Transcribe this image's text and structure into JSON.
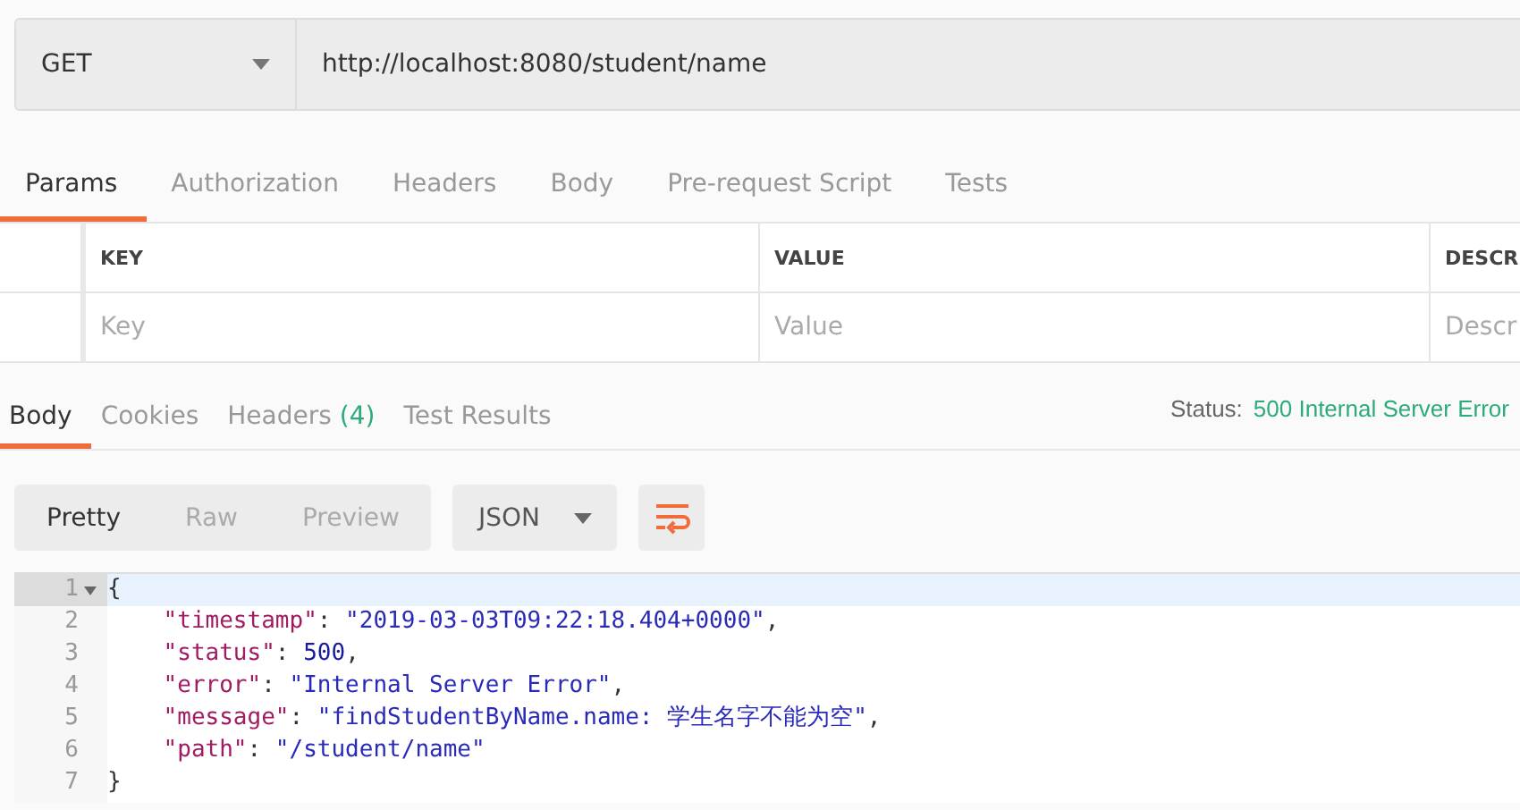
{
  "request": {
    "method": "GET",
    "url": "http://localhost:8080/student/name"
  },
  "request_tabs": [
    {
      "label": "Params",
      "selected": true
    },
    {
      "label": "Authorization",
      "selected": false
    },
    {
      "label": "Headers",
      "selected": false
    },
    {
      "label": "Body",
      "selected": false
    },
    {
      "label": "Pre-request Script",
      "selected": false
    },
    {
      "label": "Tests",
      "selected": false
    }
  ],
  "params_table": {
    "columns": [
      "KEY",
      "VALUE",
      "DESCR"
    ],
    "placeholders": [
      "Key",
      "Value",
      "Descr"
    ]
  },
  "response_tabs": [
    {
      "label": "Body",
      "selected": true
    },
    {
      "label": "Cookies",
      "selected": false
    },
    {
      "label": "Headers",
      "count": "(4)",
      "selected": false
    },
    {
      "label": "Test Results",
      "selected": false
    }
  ],
  "status": {
    "label": "Status:",
    "value": "500 Internal Server Error"
  },
  "view_modes": [
    {
      "label": "Pretty",
      "selected": true
    },
    {
      "label": "Raw",
      "selected": false
    },
    {
      "label": "Preview",
      "selected": false
    }
  ],
  "format": "JSON",
  "code": {
    "lines": [
      {
        "number": "1",
        "selected": true,
        "foldable": true,
        "tokens": [
          {
            "kind": "punct",
            "text": "{"
          }
        ],
        "children": [
          {
            "number": "2",
            "selected": false,
            "foldable": false,
            "tokens": [
              {
                "kind": "key",
                "text": "\"timestamp\""
              },
              {
                "kind": "punct",
                "text": ": "
              },
              {
                "kind": "string",
                "text": "\"2019-03-03T09:22:18.404+0000\""
              },
              {
                "kind": "punct",
                "text": ","
              }
            ]
          },
          {
            "number": "3",
            "selected": false,
            "foldable": false,
            "tokens": [
              {
                "kind": "key",
                "text": "\"status\""
              },
              {
                "kind": "punct",
                "text": ": "
              },
              {
                "kind": "number",
                "text": "500"
              },
              {
                "kind": "punct",
                "text": ","
              }
            ]
          },
          {
            "number": "4",
            "selected": false,
            "foldable": false,
            "tokens": [
              {
                "kind": "key",
                "text": "\"error\""
              },
              {
                "kind": "punct",
                "text": ": "
              },
              {
                "kind": "string",
                "text": "\"Internal Server Error\""
              },
              {
                "kind": "punct",
                "text": ","
              }
            ]
          },
          {
            "number": "5",
            "selected": false,
            "foldable": false,
            "tokens": [
              {
                "kind": "key",
                "text": "\"message\""
              },
              {
                "kind": "punct",
                "text": ": "
              },
              {
                "kind": "string",
                "text": "\"findStudentByName.name: 学生名字不能为空\""
              },
              {
                "kind": "punct",
                "text": ","
              }
            ]
          },
          {
            "number": "6",
            "selected": false,
            "foldable": false,
            "tokens": [
              {
                "kind": "key",
                "text": "\"path\""
              },
              {
                "kind": "punct",
                "text": ": "
              },
              {
                "kind": "string",
                "text": "\"/student/name\""
              }
            ]
          }
        ]
      },
      {
        "number": "7",
        "selected": false,
        "foldable": false,
        "tokens": [
          {
            "kind": "punct",
            "text": "}"
          }
        ]
      }
    ]
  }
}
